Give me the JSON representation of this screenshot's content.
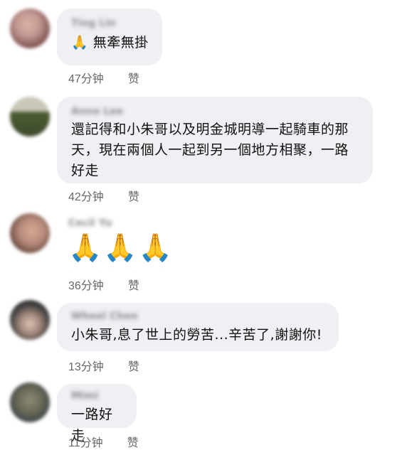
{
  "comments": [
    {
      "author": "Ting Lin",
      "text": "🙏 無牽無掛",
      "time": "47分钟",
      "like": "赞",
      "avatar_colors": [
        "#c49a93",
        "#7a4e4d"
      ]
    },
    {
      "author": "Anno Lee",
      "text": "還記得和小朱哥以及明金城明導一起騎車的那\n天，現在兩個人一起到另一個地方相聚，一路\n好走",
      "time": "42分钟",
      "like": "赞",
      "avatar_colors": [
        "#4d5b35",
        "#c9c7b8"
      ]
    },
    {
      "author": "Cecil Yu",
      "text": "🙏🙏🙏",
      "time": "36分钟",
      "like": "赞",
      "avatar_colors": [
        "#b88c7c",
        "#5b3d32"
      ]
    },
    {
      "author": "Wheel Chen",
      "text": "小朱哥,息了世上的勞苦...辛苦了,謝謝你!",
      "time": "13分钟",
      "like": "赞",
      "avatar_colors": [
        "#3a3a3a",
        "#d9c2b4"
      ]
    },
    {
      "author": "Mimi",
      "text": "一路好走",
      "time": "11分钟",
      "like": "赞",
      "avatar_colors": [
        "#6b6a57",
        "#2f3c44"
      ]
    }
  ]
}
